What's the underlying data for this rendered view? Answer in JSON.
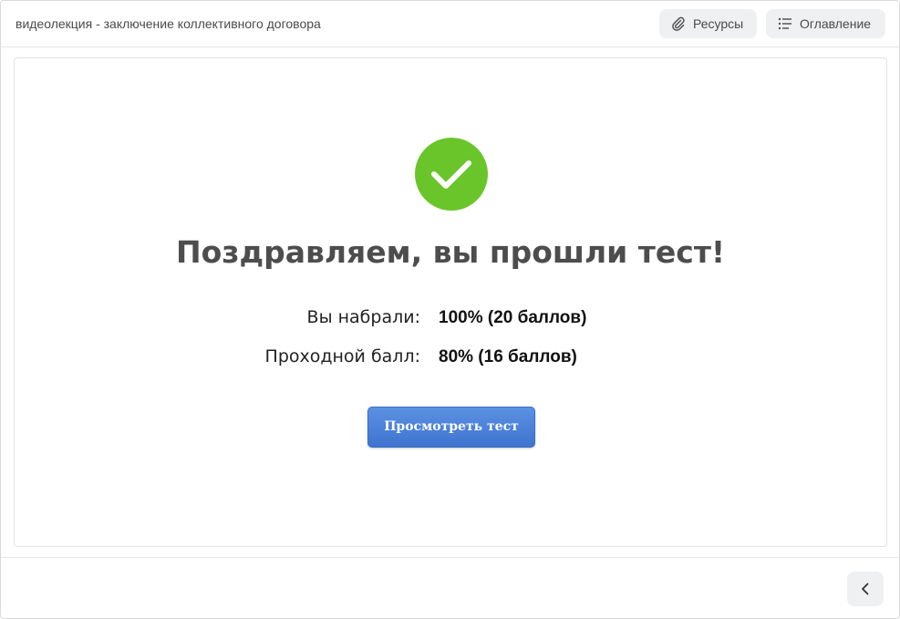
{
  "header": {
    "course_title": "видеолекция - заключение коллективного договора",
    "resources_label": "Ресурсы",
    "toc_label": "Оглавление",
    "resources_icon": "paperclip-icon",
    "toc_icon": "list-icon"
  },
  "result": {
    "status_icon": "checkmark-icon",
    "status_color": "#6ac52a",
    "headline": "Поздравляем, вы прошли тест!",
    "score_label": "Вы набрали:",
    "score_value": "100% (20 баллов)",
    "pass_label": "Проходной балл:",
    "pass_value": "80% (16 баллов)",
    "review_button_label": "Просмотреть тест",
    "accent_color": "#4a80d8"
  },
  "footer": {
    "back_icon": "chevron-left-icon"
  }
}
